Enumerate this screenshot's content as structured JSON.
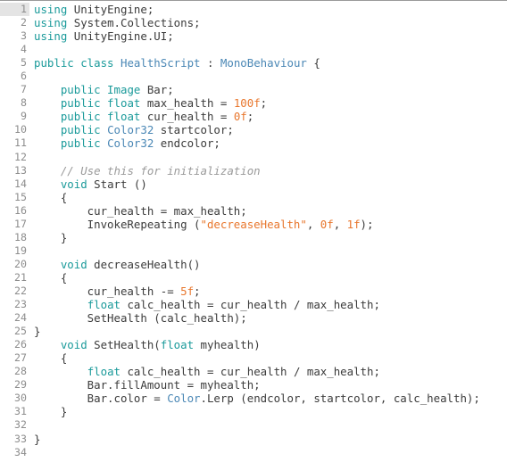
{
  "document": {
    "language": "csharp",
    "filename_implied": "HealthScript",
    "total_lines": 34,
    "active_line": 1,
    "theme": {
      "background": "#ffffff",
      "text": "#3b3b3b",
      "gutter_text": "#8d8d8d",
      "active_line_gutter": "#e4e4e4",
      "keyword": "#1a9a9a",
      "type": "#4a87b5",
      "number": "#e8762c",
      "string": "#e8762c",
      "comment": "#9a9a9a",
      "top_border": "#9a9a9a"
    }
  },
  "lines": [
    {
      "n": "1",
      "tokens": [
        {
          "t": "using ",
          "c": "kw"
        },
        {
          "t": "UnityEngine;",
          "c": "txt"
        }
      ]
    },
    {
      "n": "2",
      "tokens": [
        {
          "t": "using ",
          "c": "kw"
        },
        {
          "t": "System.Collections;",
          "c": "txt"
        }
      ]
    },
    {
      "n": "3",
      "tokens": [
        {
          "t": "using ",
          "c": "kw"
        },
        {
          "t": "UnityEngine.UI;",
          "c": "txt"
        }
      ]
    },
    {
      "n": "4",
      "tokens": []
    },
    {
      "n": "5",
      "tokens": [
        {
          "t": "public class ",
          "c": "kw"
        },
        {
          "t": "HealthScript",
          "c": "type"
        },
        {
          "t": " : ",
          "c": "txt"
        },
        {
          "t": "MonoBehaviour",
          "c": "type"
        },
        {
          "t": " {",
          "c": "txt"
        }
      ]
    },
    {
      "n": "6",
      "tokens": []
    },
    {
      "n": "7",
      "tokens": [
        {
          "t": "    ",
          "c": "txt"
        },
        {
          "t": "public Image ",
          "c": "kw"
        },
        {
          "t": "Bar;",
          "c": "txt"
        }
      ]
    },
    {
      "n": "8",
      "tokens": [
        {
          "t": "    ",
          "c": "txt"
        },
        {
          "t": "public float ",
          "c": "kw"
        },
        {
          "t": "max_health = ",
          "c": "txt"
        },
        {
          "t": "100f",
          "c": "num"
        },
        {
          "t": ";",
          "c": "txt"
        }
      ]
    },
    {
      "n": "9",
      "tokens": [
        {
          "t": "    ",
          "c": "txt"
        },
        {
          "t": "public float ",
          "c": "kw"
        },
        {
          "t": "cur_health = ",
          "c": "txt"
        },
        {
          "t": "0f",
          "c": "num"
        },
        {
          "t": ";",
          "c": "txt"
        }
      ]
    },
    {
      "n": "10",
      "tokens": [
        {
          "t": "    ",
          "c": "txt"
        },
        {
          "t": "public ",
          "c": "kw"
        },
        {
          "t": "Color32",
          "c": "type"
        },
        {
          "t": " startcolor;",
          "c": "txt"
        }
      ]
    },
    {
      "n": "11",
      "tokens": [
        {
          "t": "    ",
          "c": "txt"
        },
        {
          "t": "public ",
          "c": "kw"
        },
        {
          "t": "Color32",
          "c": "type"
        },
        {
          "t": " endcolor;",
          "c": "txt"
        }
      ]
    },
    {
      "n": "12",
      "tokens": []
    },
    {
      "n": "13",
      "tokens": [
        {
          "t": "    ",
          "c": "txt"
        },
        {
          "t": "// Use this for initialization",
          "c": "com"
        }
      ]
    },
    {
      "n": "14",
      "tokens": [
        {
          "t": "    ",
          "c": "txt"
        },
        {
          "t": "void ",
          "c": "kw"
        },
        {
          "t": "Start ()",
          "c": "txt"
        }
      ]
    },
    {
      "n": "15",
      "tokens": [
        {
          "t": "    {",
          "c": "txt"
        }
      ]
    },
    {
      "n": "16",
      "tokens": [
        {
          "t": "        cur_health = max_health;",
          "c": "txt"
        }
      ]
    },
    {
      "n": "17",
      "tokens": [
        {
          "t": "        InvokeRepeating (",
          "c": "txt"
        },
        {
          "t": "\"decreaseHealth\"",
          "c": "str"
        },
        {
          "t": ", ",
          "c": "txt"
        },
        {
          "t": "0f",
          "c": "num"
        },
        {
          "t": ", ",
          "c": "txt"
        },
        {
          "t": "1f",
          "c": "num"
        },
        {
          "t": ");",
          "c": "txt"
        }
      ]
    },
    {
      "n": "18",
      "tokens": [
        {
          "t": "    }",
          "c": "txt"
        }
      ]
    },
    {
      "n": "19",
      "tokens": []
    },
    {
      "n": "20",
      "tokens": [
        {
          "t": "    ",
          "c": "txt"
        },
        {
          "t": "void ",
          "c": "kw"
        },
        {
          "t": "decreaseHealth()",
          "c": "txt"
        }
      ]
    },
    {
      "n": "21",
      "tokens": [
        {
          "t": "    {",
          "c": "txt"
        }
      ]
    },
    {
      "n": "22",
      "tokens": [
        {
          "t": "        cur_health -= ",
          "c": "txt"
        },
        {
          "t": "5f",
          "c": "num"
        },
        {
          "t": ";",
          "c": "txt"
        }
      ]
    },
    {
      "n": "23",
      "tokens": [
        {
          "t": "        ",
          "c": "txt"
        },
        {
          "t": "float ",
          "c": "kw"
        },
        {
          "t": "calc_health = cur_health / max_health;",
          "c": "txt"
        }
      ]
    },
    {
      "n": "24",
      "tokens": [
        {
          "t": "        SetHealth (calc_health);",
          "c": "txt"
        }
      ]
    },
    {
      "n": "25",
      "tokens": [
        {
          "t": "}",
          "c": "txt"
        }
      ]
    },
    {
      "n": "26",
      "tokens": [
        {
          "t": "    ",
          "c": "txt"
        },
        {
          "t": "void ",
          "c": "kw"
        },
        {
          "t": "SetHealth(",
          "c": "txt"
        },
        {
          "t": "float ",
          "c": "kw"
        },
        {
          "t": "myhealth)",
          "c": "txt"
        }
      ]
    },
    {
      "n": "27",
      "tokens": [
        {
          "t": "    {",
          "c": "txt"
        }
      ]
    },
    {
      "n": "28",
      "tokens": [
        {
          "t": "        ",
          "c": "txt"
        },
        {
          "t": "float ",
          "c": "kw"
        },
        {
          "t": "calc_health = cur_health / max_health;",
          "c": "txt"
        }
      ]
    },
    {
      "n": "29",
      "tokens": [
        {
          "t": "        Bar.fillAmount = myhealth;",
          "c": "txt"
        }
      ]
    },
    {
      "n": "30",
      "tokens": [
        {
          "t": "        Bar.color = ",
          "c": "txt"
        },
        {
          "t": "Color",
          "c": "type"
        },
        {
          "t": ".Lerp (endcolor, startcolor, calc_health);",
          "c": "txt"
        }
      ]
    },
    {
      "n": "31",
      "tokens": [
        {
          "t": "    }",
          "c": "txt"
        }
      ]
    },
    {
      "n": "32",
      "tokens": []
    },
    {
      "n": "33",
      "tokens": [
        {
          "t": "}",
          "c": "txt"
        }
      ]
    },
    {
      "n": "34",
      "tokens": []
    }
  ]
}
